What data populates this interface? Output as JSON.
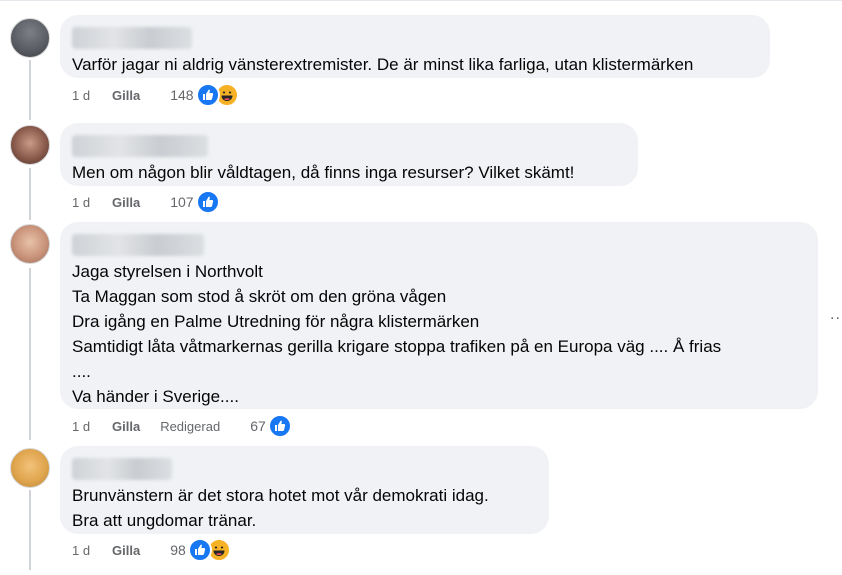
{
  "comments": [
    {
      "text": "Varför jagar ni aldrig vänsterextremister. De är minst lika farliga, utan klistermärken",
      "time": "1 d",
      "like_label": "Gilla",
      "edited": "",
      "count": "148",
      "reactions": [
        "like-icon",
        "haha-icon"
      ]
    },
    {
      "text": "Men om någon blir våldtagen, då finns inga resurser? Vilket skämt!",
      "time": "1 d",
      "like_label": "Gilla",
      "edited": "",
      "count": "107",
      "reactions": [
        "like-icon"
      ]
    },
    {
      "text": "Jaga styrelsen i Northvolt\nTa Maggan som stod å skröt om den gröna vågen\nDra igång en Palme Utredning för några klistermärken\nSamtidigt låta våtmarkernas gerilla krigare stoppa trafiken på en Europa väg .... Å frias\n....\nVa händer i Sverige....",
      "time": "1 d",
      "like_label": "Gilla",
      "edited": "Redigerad",
      "count": "67",
      "reactions": [
        "like-icon"
      ]
    },
    {
      "text": "Brunvänstern är det stora hotet mot vår demokrati idag.\nBra att ungdomar tränar.",
      "time": "1 d",
      "like_label": "Gilla",
      "edited": "",
      "count": "98",
      "reactions": [
        "like-icon",
        "haha-icon"
      ]
    }
  ],
  "more_options": "..."
}
